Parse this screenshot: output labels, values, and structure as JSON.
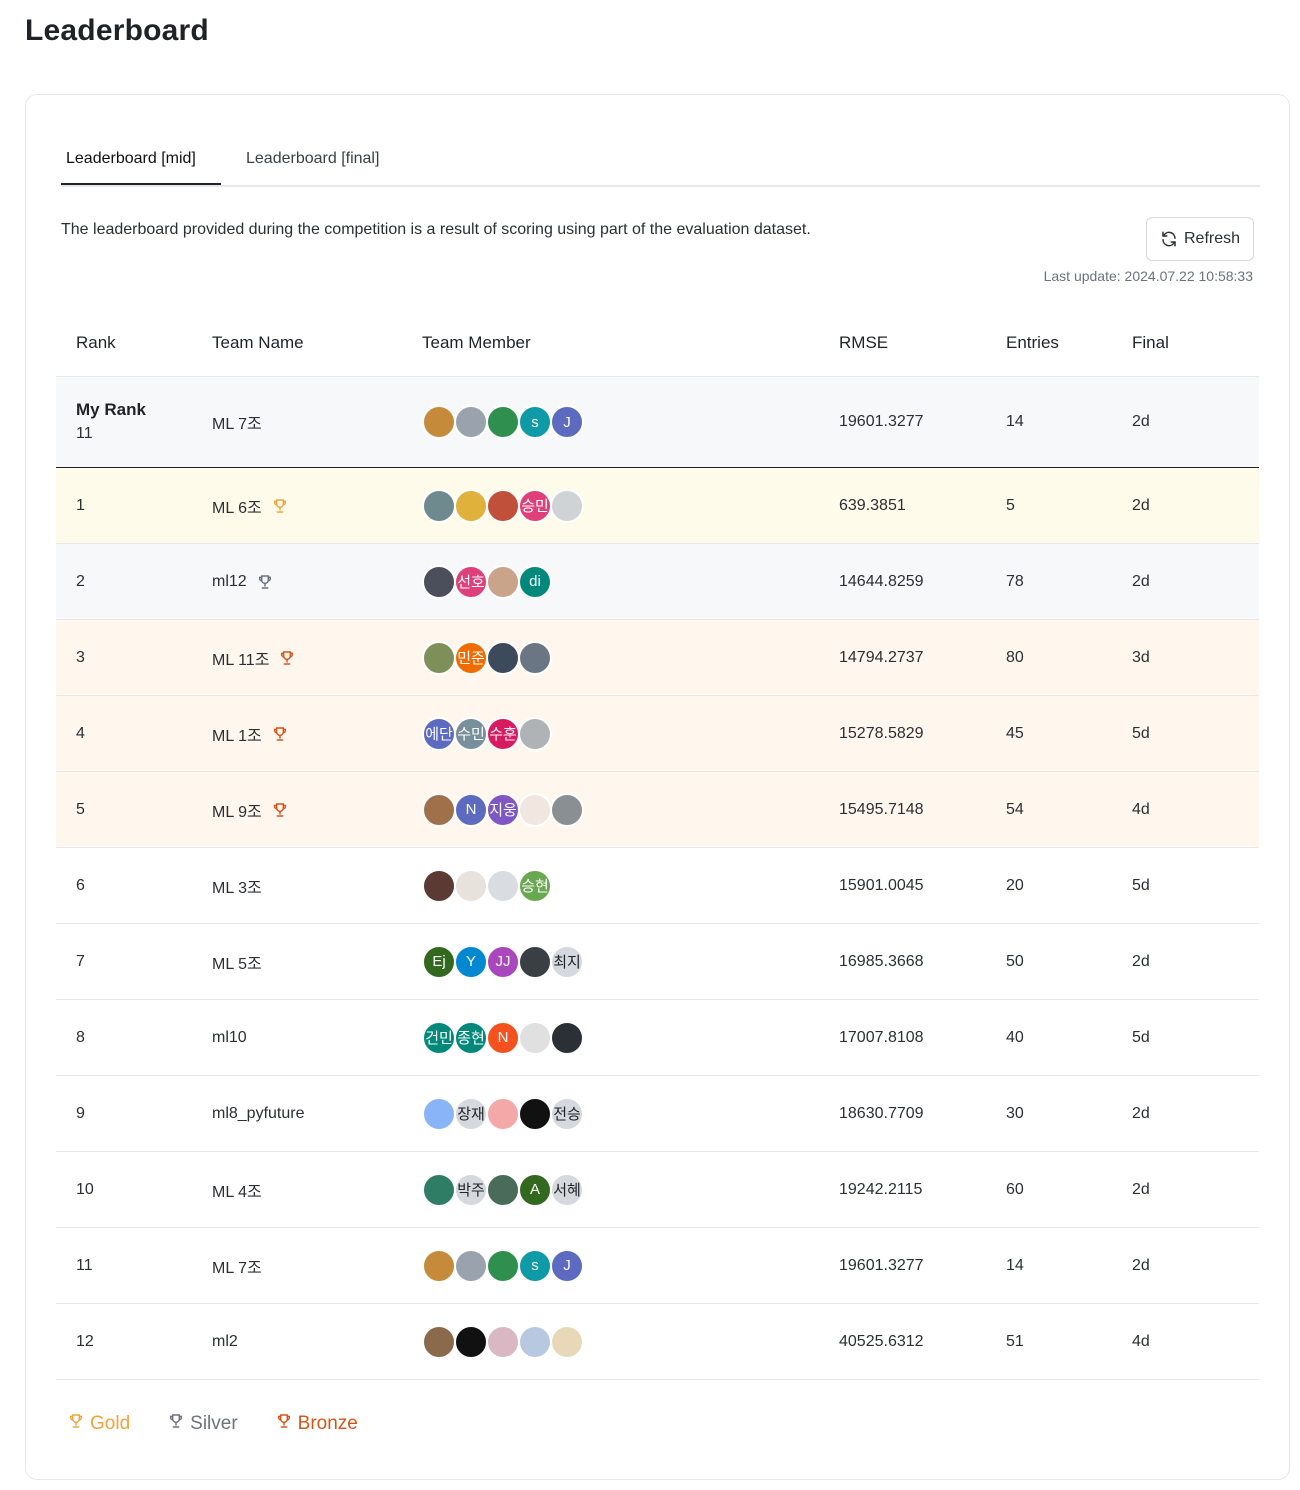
{
  "page": {
    "title": "Leaderboard"
  },
  "tabs": [
    {
      "label": "Leaderboard [mid]",
      "active": true
    },
    {
      "label": "Leaderboard [final]",
      "active": false
    }
  ],
  "description": "The leaderboard provided during the competition is a result of scoring using part of the evaluation dataset.",
  "refresh_label": "Refresh",
  "last_update": "Last update: 2024.07.22 10:58:33",
  "columns": {
    "rank": "Rank",
    "team": "Team Name",
    "members": "Team Member",
    "rmse": "RMSE",
    "entries": "Entries",
    "final": "Final"
  },
  "my_rank": {
    "label": "My Rank",
    "rank": "11",
    "team": "ML 7조",
    "rmse": "19601.3277",
    "entries": "14",
    "final": "2d",
    "members": [
      {
        "text": "",
        "color": "#c58a3a"
      },
      {
        "text": "",
        "color": "#9aa3ad"
      },
      {
        "text": "",
        "color": "#2f8f4e"
      },
      {
        "text": "s",
        "color": "#0e9aa7"
      },
      {
        "text": "J",
        "color": "#5c6bc0"
      }
    ]
  },
  "rows": [
    {
      "rank": "1",
      "team": "ML 6조",
      "medal": "gold",
      "rmse": "639.3851",
      "entries": "5",
      "final": "2d",
      "members": [
        {
          "text": "",
          "color": "#6f8a8f"
        },
        {
          "text": "",
          "color": "#e0b13b"
        },
        {
          "text": "",
          "color": "#c0503a"
        },
        {
          "text": "승민",
          "color": "#e0407a"
        },
        {
          "text": "",
          "color": "#d0d3d6"
        }
      ]
    },
    {
      "rank": "2",
      "team": "ml12",
      "medal": "silver",
      "rmse": "14644.8259",
      "entries": "78",
      "final": "2d",
      "members": [
        {
          "text": "",
          "color": "#4b4f5c"
        },
        {
          "text": "선호",
          "color": "#e0407a"
        },
        {
          "text": "",
          "color": "#c9a48a"
        },
        {
          "text": "di",
          "color": "#00897b"
        }
      ]
    },
    {
      "rank": "3",
      "team": "ML 11조",
      "medal": "bronze",
      "rmse": "14794.2737",
      "entries": "80",
      "final": "3d",
      "members": [
        {
          "text": "",
          "color": "#7f8f5a"
        },
        {
          "text": "민준",
          "color": "#ef6c00"
        },
        {
          "text": "",
          "color": "#3d4a5c"
        },
        {
          "text": "",
          "color": "#6b7684"
        }
      ]
    },
    {
      "rank": "4",
      "team": "ML 1조",
      "medal": "bronze",
      "rmse": "15278.5829",
      "entries": "45",
      "final": "5d",
      "members": [
        {
          "text": "에단",
          "color": "#5c6bc0"
        },
        {
          "text": "수민",
          "color": "#78909c"
        },
        {
          "text": "수훈",
          "color": "#d81b60"
        },
        {
          "text": "",
          "color": "#b0b3b6"
        }
      ]
    },
    {
      "rank": "5",
      "team": "ML 9조",
      "medal": "bronze",
      "rmse": "15495.7148",
      "entries": "54",
      "final": "4d",
      "members": [
        {
          "text": "",
          "color": "#a0704a"
        },
        {
          "text": "N",
          "color": "#5c6bc0"
        },
        {
          "text": "지웅",
          "color": "#7e57c2"
        },
        {
          "text": "",
          "color": "#f1e6e0"
        },
        {
          "text": "",
          "color": "#8a8f94"
        }
      ]
    },
    {
      "rank": "6",
      "team": "ML 3조",
      "medal": "",
      "rmse": "15901.0045",
      "entries": "20",
      "final": "5d",
      "members": [
        {
          "text": "",
          "color": "#5a3a32"
        },
        {
          "text": "",
          "color": "#e8e2dc"
        },
        {
          "text": "",
          "color": "#d9dde2"
        },
        {
          "text": "승현",
          "color": "#6aa84f"
        }
      ]
    },
    {
      "rank": "7",
      "team": "ML 5조",
      "medal": "",
      "rmse": "16985.3668",
      "entries": "50",
      "final": "2d",
      "members": [
        {
          "text": "Ej",
          "color": "#33691e"
        },
        {
          "text": "Y",
          "color": "#0288d1"
        },
        {
          "text": "JJ",
          "color": "#ab47bc"
        },
        {
          "text": "",
          "color": "#3a3f44"
        },
        {
          "text": "최지",
          "color": "#d5d8dc",
          "dark": true
        }
      ]
    },
    {
      "rank": "8",
      "team": "ml10",
      "medal": "",
      "rmse": "17007.8108",
      "entries": "40",
      "final": "5d",
      "members": [
        {
          "text": "건민",
          "color": "#00897b"
        },
        {
          "text": "종현",
          "color": "#00897b"
        },
        {
          "text": "N",
          "color": "#f4511e"
        },
        {
          "text": "",
          "color": "#e0e0e0"
        },
        {
          "text": "",
          "color": "#2b3036"
        }
      ]
    },
    {
      "rank": "9",
      "team": "ml8_pyfuture",
      "medal": "",
      "rmse": "18630.7709",
      "entries": "30",
      "final": "2d",
      "members": [
        {
          "text": "",
          "color": "#8ab4f8"
        },
        {
          "text": "장재",
          "color": "#d5d8dc",
          "dark": true
        },
        {
          "text": "",
          "color": "#f4a8a8"
        },
        {
          "text": "",
          "color": "#111111"
        },
        {
          "text": "전승",
          "color": "#d5d8dc",
          "dark": true
        }
      ]
    },
    {
      "rank": "10",
      "team": "ML 4조",
      "medal": "",
      "rmse": "19242.2115",
      "entries": "60",
      "final": "2d",
      "members": [
        {
          "text": "",
          "color": "#2e7d64"
        },
        {
          "text": "박주",
          "color": "#d5d8dc",
          "dark": true
        },
        {
          "text": "",
          "color": "#4a6a5a"
        },
        {
          "text": "A",
          "color": "#33691e"
        },
        {
          "text": "서혜",
          "color": "#d5d8dc",
          "dark": true
        }
      ]
    },
    {
      "rank": "11",
      "team": "ML 7조",
      "medal": "",
      "rmse": "19601.3277",
      "entries": "14",
      "final": "2d",
      "members": [
        {
          "text": "",
          "color": "#c58a3a"
        },
        {
          "text": "",
          "color": "#9aa3ad"
        },
        {
          "text": "",
          "color": "#2f8f4e"
        },
        {
          "text": "s",
          "color": "#0e9aa7"
        },
        {
          "text": "J",
          "color": "#5c6bc0"
        }
      ]
    },
    {
      "rank": "12",
      "team": "ml2",
      "medal": "",
      "rmse": "40525.6312",
      "entries": "51",
      "final": "4d",
      "members": [
        {
          "text": "",
          "color": "#8a6a4a"
        },
        {
          "text": "",
          "color": "#111111"
        },
        {
          "text": "",
          "color": "#d9b8c4"
        },
        {
          "text": "",
          "color": "#b8c8e0"
        },
        {
          "text": "",
          "color": "#e8d8b8"
        }
      ]
    }
  ],
  "legend": [
    {
      "label": "Gold",
      "color": "#f0a33a"
    },
    {
      "label": "Silver",
      "color": "#6b7280"
    },
    {
      "label": "Bronze",
      "color": "#d2561c"
    }
  ],
  "medal_colors": {
    "gold": "#f0a33a",
    "silver": "#6b7280",
    "bronze": "#d2561c"
  }
}
